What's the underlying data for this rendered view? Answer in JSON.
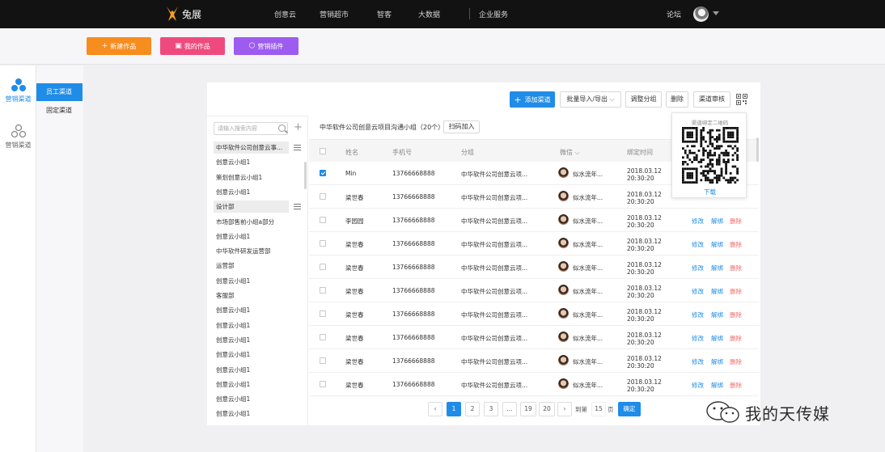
{
  "topbar": {
    "brand": "兔展",
    "nav": [
      "创意云",
      "营销超市",
      "智客",
      "大数据",
      "企业服务"
    ],
    "forum": "论坛"
  },
  "actions": [
    {
      "label": "新建作品",
      "icon": "plus-icon",
      "color": "#f78c1f"
    },
    {
      "label": "我的作品",
      "icon": "works-icon",
      "color": "#ef4a7e"
    },
    {
      "label": "营销插件",
      "icon": "plugin-icon",
      "color": "#9d5bf0"
    }
  ],
  "sidebar": {
    "items": [
      {
        "label": "营销渠道",
        "icon": "channel-icon",
        "active": true
      },
      {
        "label": "营销渠道",
        "icon": "channel-outline-icon",
        "active": false
      }
    ]
  },
  "subnav": {
    "items": [
      {
        "label": "员工渠道",
        "active": true
      },
      {
        "label": "固定渠道",
        "active": false
      }
    ]
  },
  "toolbar": {
    "add": "添加渠道",
    "import": "批量导入/导出",
    "regroup": "调整分组",
    "delete": "删除",
    "review": "渠道审核"
  },
  "groups": {
    "search_placeholder": "请输入搜索内容",
    "items": [
      {
        "label": "中华软件公司创意云事...",
        "highlight": true,
        "menu": true
      },
      {
        "label": "创意云小组1"
      },
      {
        "label": "策划创意云小组1"
      },
      {
        "label": "创意云小组1"
      },
      {
        "label": "设计部",
        "highlight": true,
        "menu": true
      },
      {
        "label": "市场部售前小组a部分"
      },
      {
        "label": "创意云小组1"
      },
      {
        "label": "中华软件研发运营部"
      },
      {
        "label": "运营部"
      },
      {
        "label": "创意云小组1"
      },
      {
        "label": "客服部"
      },
      {
        "label": "创意云小组1"
      },
      {
        "label": "创意云小组1"
      },
      {
        "label": "创意云小组1"
      },
      {
        "label": "创意云小组1"
      },
      {
        "label": "创意云小组1"
      },
      {
        "label": "创意云小组1"
      },
      {
        "label": "创意云小组1"
      },
      {
        "label": "创意云小组1"
      }
    ]
  },
  "table": {
    "group_title": "中华软件公司创意云项目沟通小组（20个）",
    "scan_join": "扫码加入",
    "headers": [
      "姓名",
      "手机号",
      "分组",
      "微信",
      "绑定时间"
    ],
    "rows": [
      {
        "name": "Min",
        "phone": "13766668888",
        "group": "中华软件公司创意云项...",
        "wechat": "似水流年...",
        "date": "2018.03.12",
        "time": "20:30:20",
        "checked": true,
        "ops": false
      },
      {
        "name": "梁世春",
        "phone": "13766668888",
        "group": "中华软件公司创意云项...",
        "wechat": "似水流年...",
        "date": "2018.03.12",
        "time": "20:30:20",
        "checked": false,
        "ops": false
      },
      {
        "name": "李园园",
        "phone": "13766668888",
        "group": "中华软件公司创意云项...",
        "wechat": "似水流年...",
        "date": "2018.03.12",
        "time": "20:30:20",
        "checked": false,
        "ops": true
      },
      {
        "name": "梁世春",
        "phone": "13766668888",
        "group": "中华软件公司创意云项...",
        "wechat": "似水流年...",
        "date": "2018.03.12",
        "time": "20:30:20",
        "checked": false,
        "ops": true
      },
      {
        "name": "梁世春",
        "phone": "13766668888",
        "group": "中华软件公司创意云项...",
        "wechat": "似水流年...",
        "date": "2018.03.12",
        "time": "20:30:20",
        "checked": false,
        "ops": true
      },
      {
        "name": "梁世春",
        "phone": "13766668888",
        "group": "中华软件公司创意云项...",
        "wechat": "似水流年...",
        "date": "2018.03.12",
        "time": "20:30:20",
        "checked": false,
        "ops": true
      },
      {
        "name": "梁世春",
        "phone": "13766668888",
        "group": "中华软件公司创意云项...",
        "wechat": "似水流年...",
        "date": "2018.03.12",
        "time": "20:30:20",
        "checked": false,
        "ops": true
      },
      {
        "name": "梁世春",
        "phone": "13766668888",
        "group": "中华软件公司创意云项...",
        "wechat": "似水流年...",
        "date": "2018.03.12",
        "time": "20:30:20",
        "checked": false,
        "ops": true
      },
      {
        "name": "梁世春",
        "phone": "13766668888",
        "group": "中华软件公司创意云项...",
        "wechat": "似水流年...",
        "date": "2018.03.12",
        "time": "20:30:20",
        "checked": false,
        "ops": true
      },
      {
        "name": "梁世春",
        "phone": "13766668888",
        "group": "中华软件公司创意云项...",
        "wechat": "似水流年...",
        "date": "2018.03.12",
        "time": "20:30:20",
        "checked": false,
        "ops": true
      }
    ],
    "ops": {
      "edit": "修改",
      "unbind": "解绑",
      "delete": "删除"
    }
  },
  "qr": {
    "title": "渠道绑定二维码",
    "download": "下载"
  },
  "pagination": {
    "pages": [
      "1",
      "2",
      "3",
      "...",
      "19",
      "20"
    ],
    "current": "1",
    "goto_prefix": "到第",
    "goto_value": "15",
    "goto_suffix": "页",
    "confirm": "确定"
  },
  "watermark": "我的天传媒",
  "colors": {
    "primary": "#1f8ce8",
    "danger": "#f26b6b",
    "topbar": "#121212"
  }
}
